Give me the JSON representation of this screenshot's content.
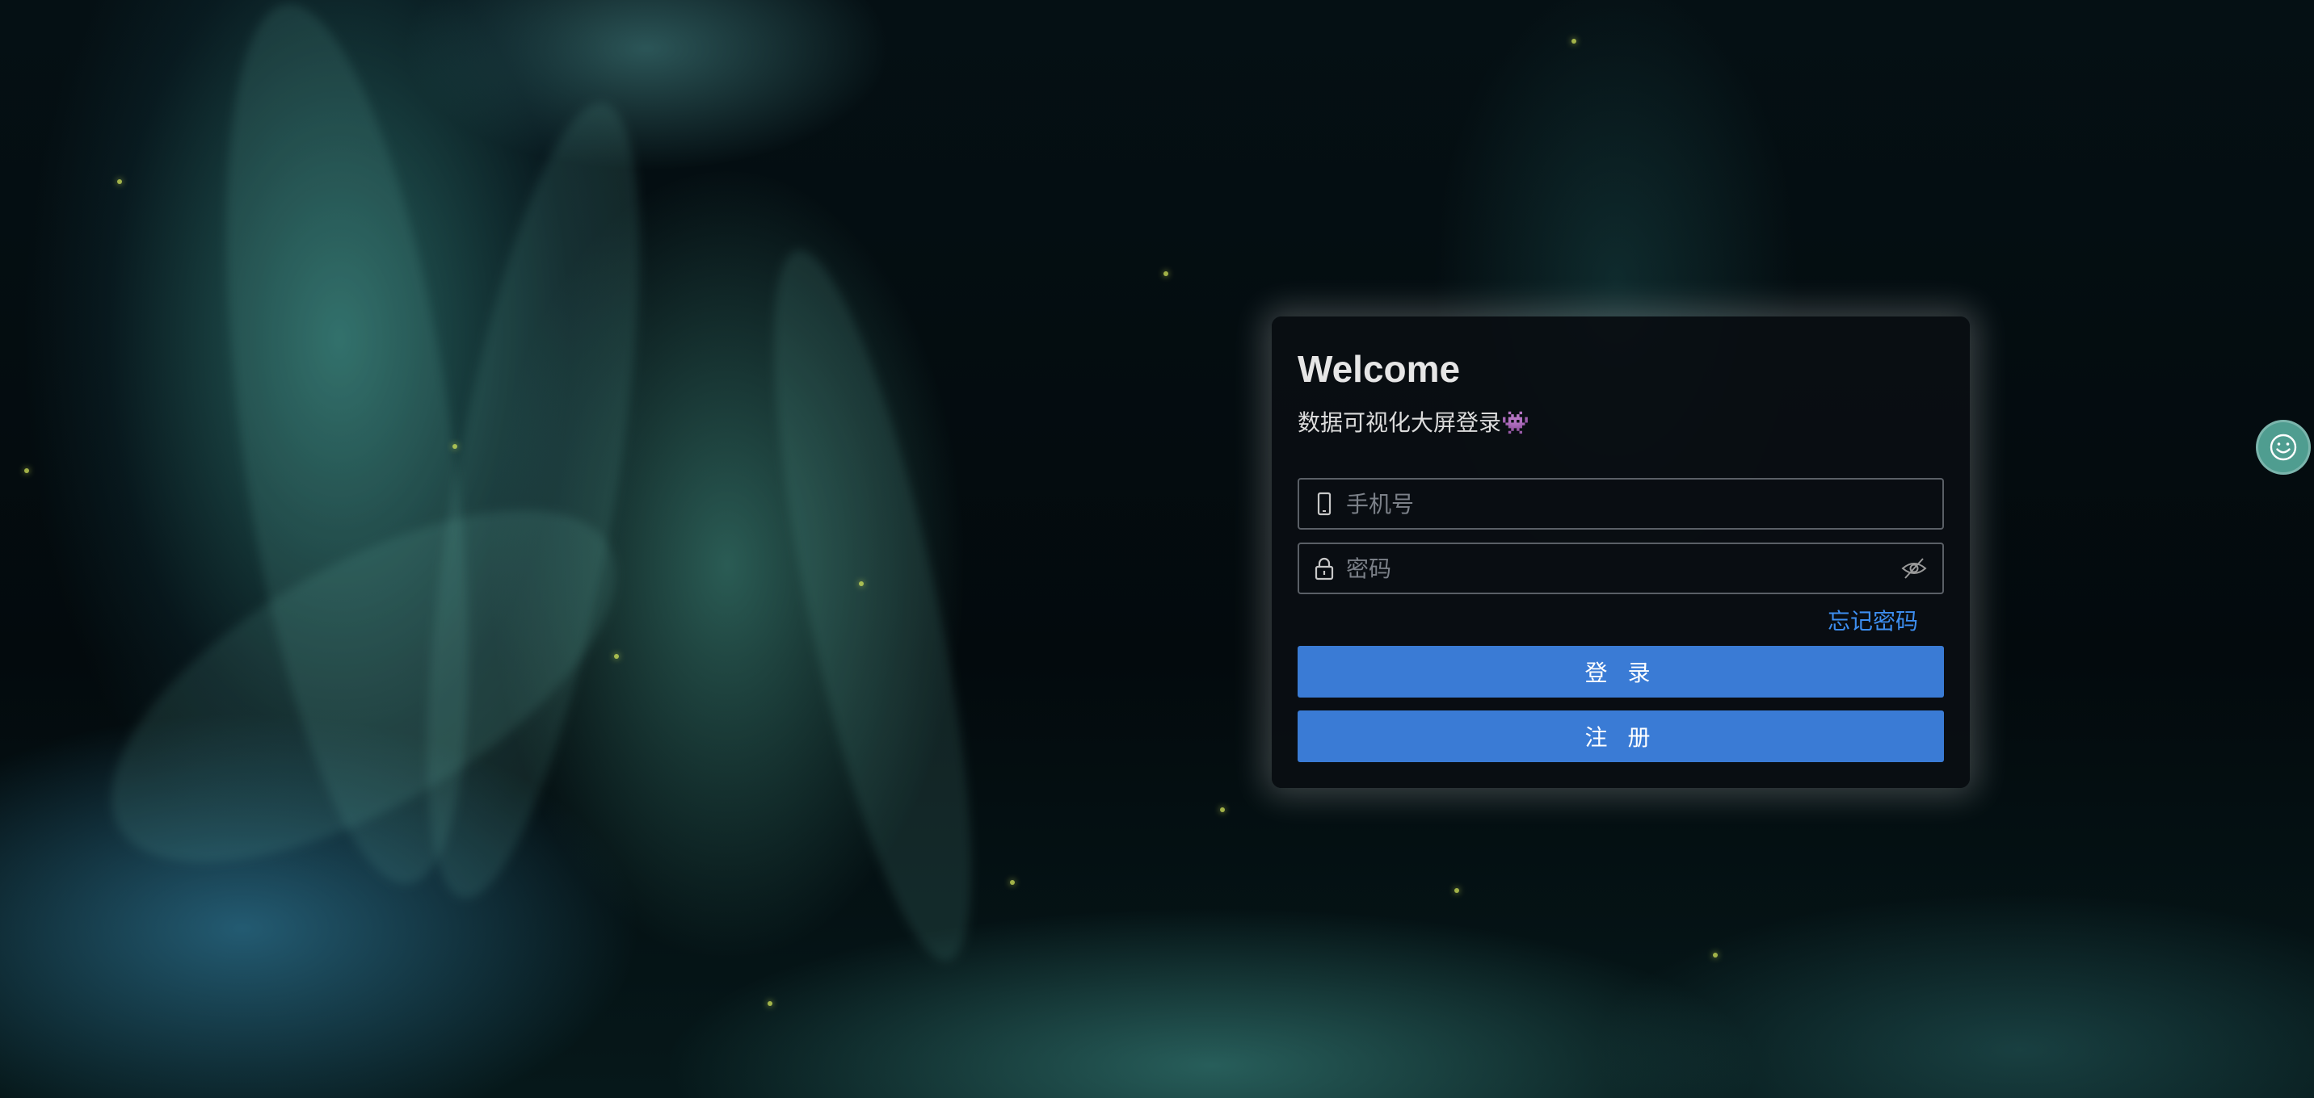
{
  "card": {
    "title": "Welcome",
    "subtitle": "数据可视化大屏登录👾",
    "phone_placeholder": "手机号",
    "password_placeholder": "密码",
    "forgot_label": "忘记密码",
    "login_label": "登 录",
    "register_label": "注 册"
  },
  "icons": {
    "phone": "mobile-phone-icon",
    "password": "lock-icon",
    "toggle": "eye-slash-icon",
    "floating": "smiley-icon"
  },
  "colors": {
    "accent": "#3a7bd5",
    "link": "#3d8ef0",
    "card_bg": "#0a0e12",
    "floating_button": "#4f9d90"
  }
}
